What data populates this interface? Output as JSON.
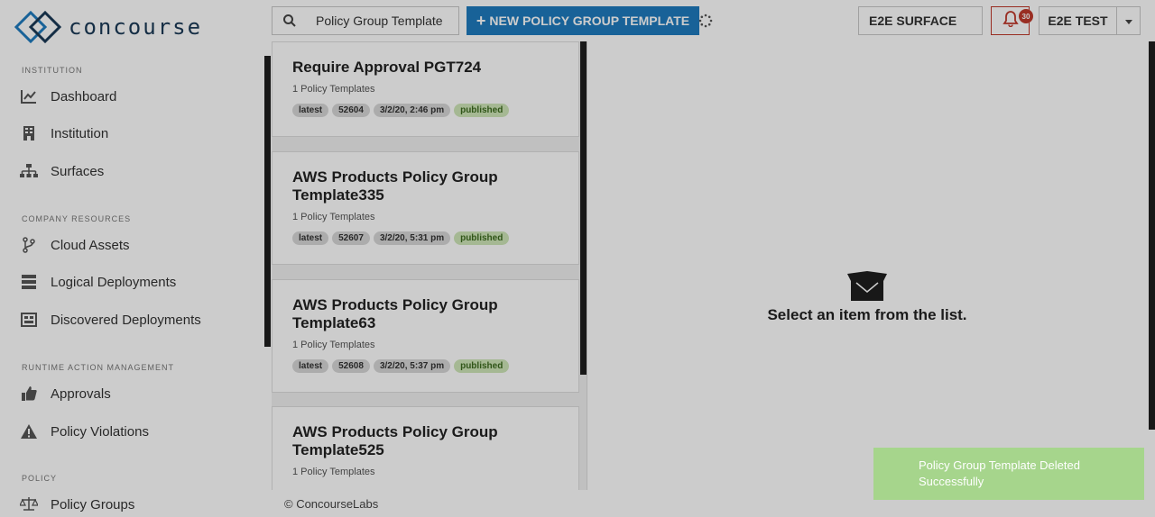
{
  "app": {
    "brand": "concourse"
  },
  "sidebar": {
    "sections": [
      {
        "title": "INSTITUTION",
        "items": [
          {
            "label": "Dashboard",
            "icon": "chart-line-icon"
          },
          {
            "label": "Institution",
            "icon": "building-icon"
          },
          {
            "label": "Surfaces",
            "icon": "sitemap-icon"
          }
        ]
      },
      {
        "title": "COMPANY RESOURCES",
        "items": [
          {
            "label": "Cloud Assets",
            "icon": "branch-icon"
          },
          {
            "label": "Logical Deployments",
            "icon": "server-icon"
          },
          {
            "label": "Discovered Deployments",
            "icon": "radar-icon"
          }
        ]
      },
      {
        "title": "RUNTIME ACTION MANAGEMENT",
        "items": [
          {
            "label": "Approvals",
            "icon": "thumbs-up-icon"
          },
          {
            "label": "Policy Violations",
            "icon": "warning-icon"
          }
        ]
      },
      {
        "title": "POLICY",
        "items": [
          {
            "label": "Policy Groups",
            "icon": "balance-scale-icon"
          }
        ]
      }
    ]
  },
  "topbar": {
    "search_value": "Policy Group Template",
    "new_button_label": "NEW POLICY GROUP TEMPLATE",
    "surface_label": "E2E SURFACE",
    "notification_count": "30",
    "user_label": "E2E TEST"
  },
  "list": {
    "items": [
      {
        "title": "Require Approval PGT724",
        "subtitle": "1 Policy Templates",
        "tags": [
          "latest",
          "52604",
          "3/2/20, 2:46 pm",
          "published"
        ]
      },
      {
        "title": "AWS Products Policy Group Template335",
        "subtitle": "1 Policy Templates",
        "tags": [
          "latest",
          "52607",
          "3/2/20, 5:31 pm",
          "published"
        ]
      },
      {
        "title": "AWS Products Policy Group Template63",
        "subtitle": "1 Policy Templates",
        "tags": [
          "latest",
          "52608",
          "3/2/20, 5:37 pm",
          "published"
        ]
      },
      {
        "title": "AWS Products Policy Group Template525",
        "subtitle": "1 Policy Templates",
        "tags": []
      }
    ]
  },
  "footer": {
    "copyright": "© ConcourseLabs"
  },
  "detail": {
    "empty_message": "Select an item from the list."
  },
  "toast": {
    "message": "Policy Group Template Deleted Successfully"
  },
  "colors": {
    "brand_blue": "#1e7bbf",
    "published_green": "#cfe6b8",
    "toast_green": "#a6d58c",
    "alert_red": "#c0392b"
  }
}
